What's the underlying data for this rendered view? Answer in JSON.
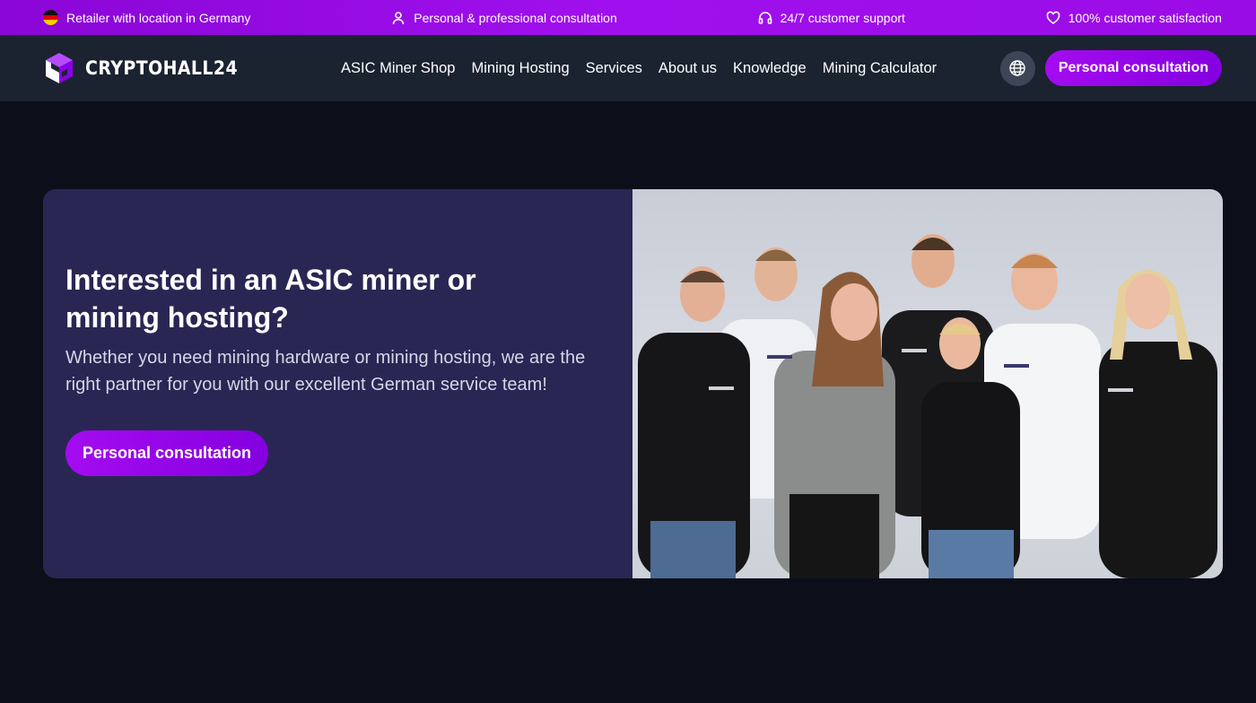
{
  "topbar": {
    "items": [
      {
        "icon": "germany-flag-icon",
        "label": "Retailer with location in Germany"
      },
      {
        "icon": "user-icon",
        "label": "Personal & professional consultation"
      },
      {
        "icon": "headset-icon",
        "label": "24/7 customer support"
      },
      {
        "icon": "heart-icon",
        "label": "100% customer satisfaction"
      }
    ],
    "colors": {
      "start": "#8a06d6",
      "end": "#9a0ce6"
    }
  },
  "header": {
    "brand": "CRYPTOHALL24",
    "nav": [
      "ASIC Miner Shop",
      "Mining Hosting",
      "Services",
      "About us",
      "Knowledge",
      "Mining Calculator"
    ],
    "language_icon": "globe-icon",
    "cta": "Personal consultation"
  },
  "hero": {
    "title": "Interested in an ASIC miner or mining hosting?",
    "text": "Whether you need mining hardware or mining hosting, we are the right partner for you with our excellent German service team!",
    "cta": "Personal consultation",
    "image": "team-photo"
  },
  "colors": {
    "background": "#0c0f1a",
    "header": "#1b2230",
    "card": "#2a2654",
    "accent": "#a50bf0"
  }
}
